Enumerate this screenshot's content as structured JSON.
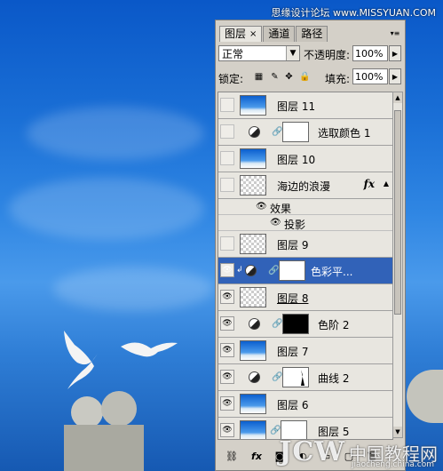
{
  "watermark_top": "思缘设计论坛 www.MISSYUAN.COM",
  "watermark_bottom": {
    "brand": "JCW",
    "cn": "中国教程网",
    "url": "jiaocheng.china.com"
  },
  "panel": {
    "tabs": [
      {
        "label": "图层",
        "close": "×",
        "active": true
      },
      {
        "label": "通道",
        "active": false
      },
      {
        "label": "路径",
        "active": false
      }
    ],
    "blend_mode": "正常",
    "opacity_label": "不透明度:",
    "opacity_value": "100%",
    "lock_label": "锁定:",
    "fill_label": "填充:",
    "fill_value": "100%",
    "layers": [
      {
        "name": "图层 11",
        "visible": false,
        "thumb": "sky"
      },
      {
        "name": "选取颜色 1",
        "visible": false,
        "thumb": "white",
        "adjustment": true
      },
      {
        "name": "图层 10",
        "visible": false,
        "thumb": "sky"
      },
      {
        "name": "海边的浪漫",
        "visible": false,
        "thumb": "trans",
        "fx": "fx"
      },
      {
        "name": "效果",
        "sub": true
      },
      {
        "name": "投影",
        "sub": true
      },
      {
        "name": "图层 9",
        "visible": false,
        "thumb": "trans"
      },
      {
        "name": "色彩平...",
        "visible": true,
        "thumb": "white",
        "adjustment": true,
        "selected": true
      },
      {
        "name": "图层 8",
        "visible": true,
        "thumb": "trans"
      },
      {
        "name": "色阶 2",
        "visible": true,
        "thumb": "black",
        "adjustment": true
      },
      {
        "name": "图层 7",
        "visible": true,
        "thumb": "sky"
      },
      {
        "name": "曲线 2",
        "visible": true,
        "thumb": "curve",
        "adjustment": true
      },
      {
        "name": "图层 6",
        "visible": true,
        "thumb": "sky"
      },
      {
        "name": "图层 5",
        "visible": true,
        "thumb": "sky"
      }
    ],
    "bottom_icons": [
      "link-icon",
      "fx-icon",
      "mask-icon",
      "adjustment-icon",
      "folder-icon",
      "new-layer-icon",
      "trash-icon"
    ]
  }
}
